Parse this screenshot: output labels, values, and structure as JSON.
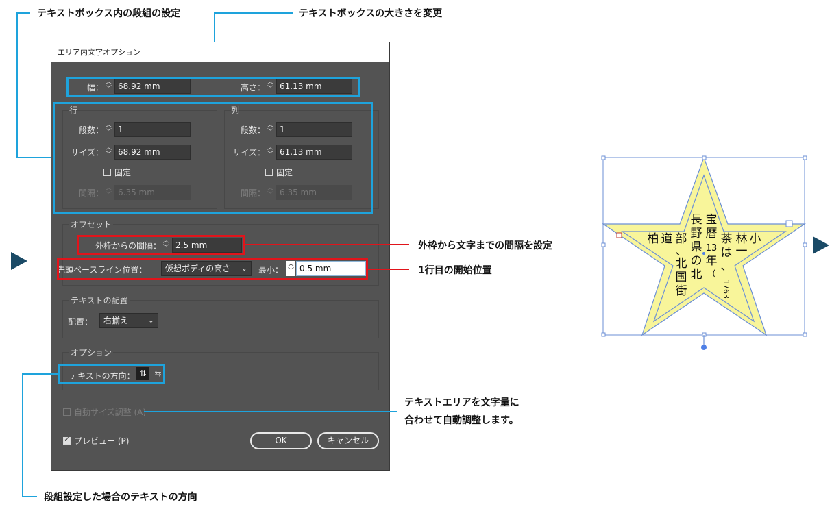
{
  "annotations": {
    "column_settings": "テキストボックス内の段組の設定",
    "box_size": "テキストボックスの大きさを変更",
    "inset_spacing": "外枠から文字までの間隔を設定",
    "first_line": "1行目の開始位置",
    "auto_size_line1": "テキストエリアを文字量に",
    "auto_size_line2": "合わせて自動調整します。",
    "text_direction": "段組設定した場合のテキストの方向"
  },
  "dialog": {
    "title": "エリア内文字オプション",
    "width_label": "幅：",
    "width_value": "68.92 mm",
    "height_label": "高さ：",
    "height_value": "61.13 mm",
    "rows": {
      "title": "行",
      "count_label": "段数：",
      "count_value": "1",
      "size_label": "サイズ：",
      "size_value": "68.92 mm",
      "fixed_label": "固定",
      "gap_label": "間隔：",
      "gap_value": "6.35 mm"
    },
    "columns": {
      "title": "列",
      "count_label": "段数：",
      "count_value": "1",
      "size_label": "サイズ：",
      "size_value": "61.13 mm",
      "fixed_label": "固定",
      "gap_label": "間隔：",
      "gap_value": "6.35 mm"
    },
    "offset": {
      "title": "オフセット",
      "inset_label": "外枠からの間隔：",
      "inset_value": "2.5 mm",
      "baseline_label": "先頭ベースライン位置：",
      "baseline_value": "仮想ボディの高さ",
      "min_label": "最小：",
      "min_value": "0.5 mm"
    },
    "alignment": {
      "title": "テキストの配置",
      "align_label": "配置：",
      "align_value": "右揃え"
    },
    "options": {
      "title": "オプション",
      "direction_label": "テキストの方向："
    },
    "auto_size_label": "自動サイズ調整 (A)",
    "preview_label": "プレビュー (P)",
    "ok_label": "OK",
    "cancel_label": "キャンセル"
  },
  "star_text": [
    "小",
    "林",
    "一",
    "茶",
    "は",
    "、",
    "宝",
    "暦",
    "13",
    "年",
    "（",
    "1763",
    "長",
    "野",
    "県",
    "の",
    "北",
    "部",
    "、",
    "北",
    "国",
    "街",
    "道",
    "柏"
  ],
  "colors": {
    "highlight_blue": "#1ea3dc",
    "highlight_red": "#e1141b",
    "star_fill": "#f8f59a",
    "star_stroke": "#6b8fd6",
    "arrow": "#1a4a66"
  }
}
